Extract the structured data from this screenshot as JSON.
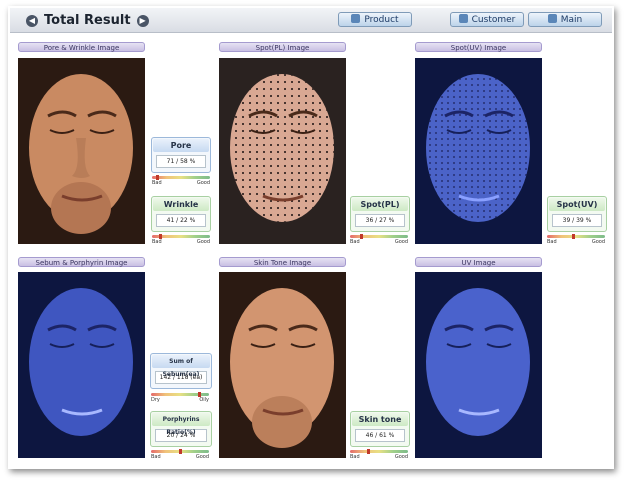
{
  "header": {
    "title": "Total Result",
    "nav": [
      {
        "label": "Product",
        "icon": "product-icon"
      },
      {
        "label": "Customer",
        "icon": "customer-icon"
      },
      {
        "label": "Main",
        "icon": "main-icon"
      }
    ]
  },
  "sections": {
    "pore_wrinkle": "Pore & Wrinkle Image",
    "spot_pl": "Spot(PL) Image",
    "spot_uv": "Spot(UV) Image",
    "sebum_porphyrin": "Sebum & Porphyrin Image",
    "skin_tone": "Skin Tone Image",
    "uv": "UV Image"
  },
  "metrics": {
    "pore": {
      "label": "Pore",
      "value": "71 / 58 %",
      "low": "Bad",
      "high": "Good",
      "level": 0.08
    },
    "wrinkle": {
      "label": "Wrinkle",
      "value": "41 / 22 %",
      "low": "Bad",
      "high": "Good",
      "level": 0.12
    },
    "spot_pl": {
      "label": "Spot(PL)",
      "value": "36 / 27 %",
      "low": "Bad",
      "high": "Good",
      "level": 0.18
    },
    "spot_uv": {
      "label": "Spot(UV)",
      "value": "39 / 39 %",
      "low": "Bad",
      "high": "Good",
      "level": 0.45
    },
    "sebum": {
      "label": "Sum of Sebum(ea)",
      "value": "142 / 118 (ea)",
      "low": "Dry",
      "high": "Oily",
      "level": 0.85
    },
    "porphyrin": {
      "label": "Porphyrins Ratio(%)",
      "value": "20 / 24 %",
      "low": "Bad",
      "high": "Good",
      "level": 0.5
    },
    "skin_tone": {
      "label": "Skin tone",
      "value": "46 / 61 %",
      "low": "Bad",
      "high": "Good",
      "level": 0.3
    }
  },
  "colors": {
    "card_blue": "#c6d9f1",
    "card_green": "#cde9c4",
    "header": "#d9dde4"
  }
}
